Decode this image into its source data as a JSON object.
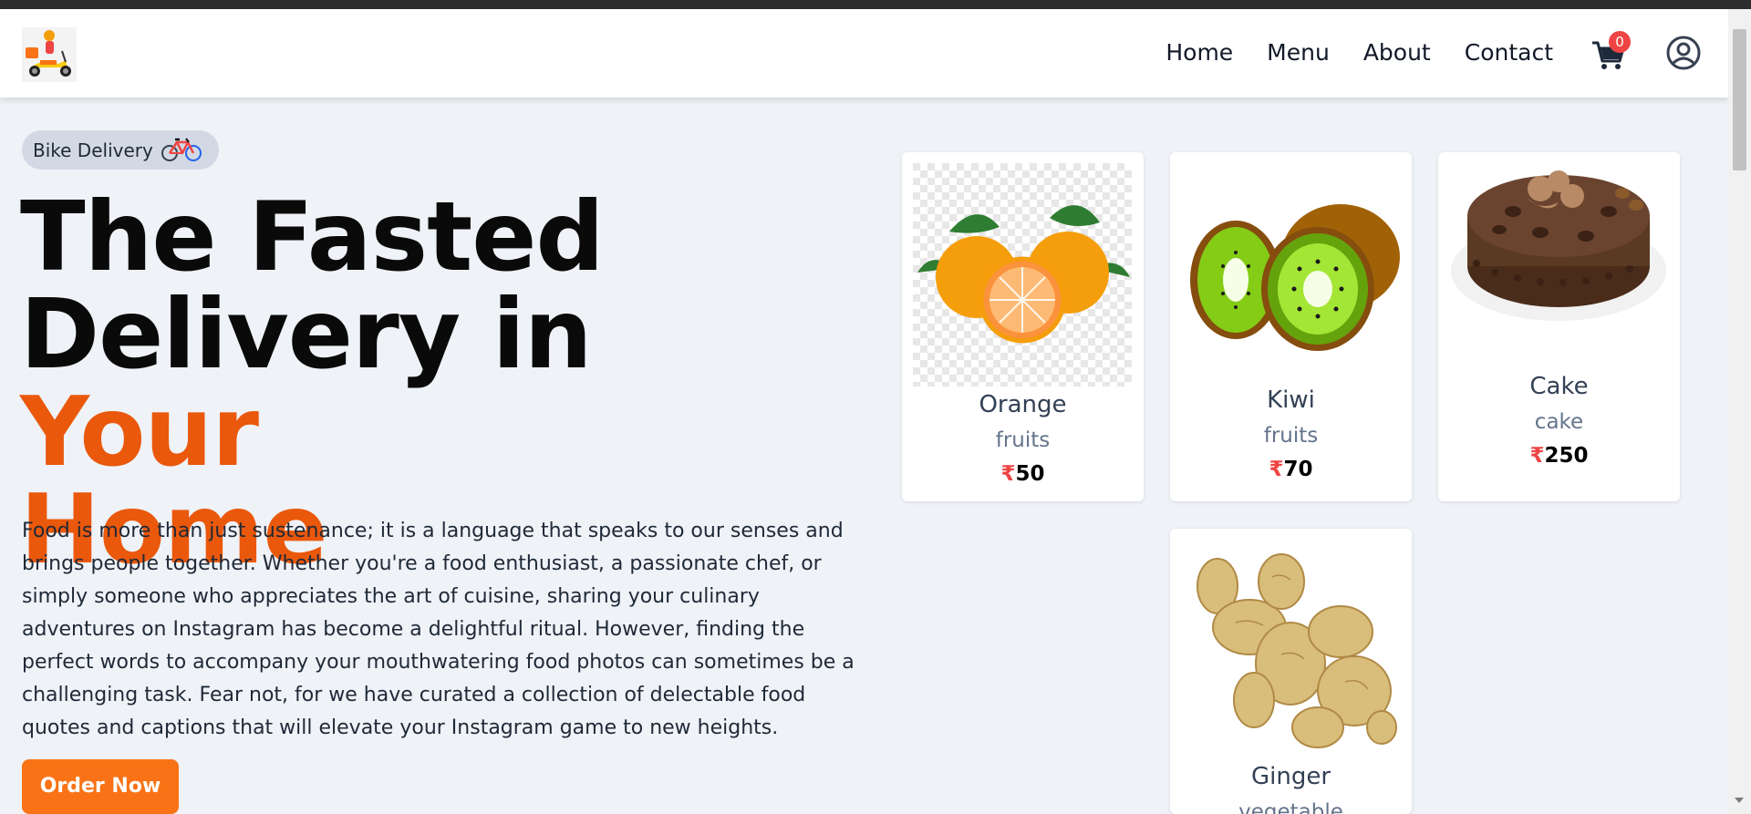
{
  "nav": {
    "logo_icon": "delivery-scooter-logo",
    "links": [
      "Home",
      "Menu",
      "About",
      "Contact"
    ],
    "cart_icon": "cart-icon",
    "cart_count": "0",
    "profile_icon": "user-circle-icon"
  },
  "hero": {
    "badge_text": "Bike Delivery",
    "badge_icon": "bicycle-icon",
    "title_line1": "The Fasted",
    "title_line2_part1": "Delivery in ",
    "title_line2_accent": "Your",
    "title_line3_accent": "Home",
    "description": "Food is more than just sustenance; it is a language that speaks to our senses and brings people together. Whether you're a food enthusiast, a passionate chef, or simply someone who appreciates the art of cuisine, sharing your culinary adventures on Instagram has become a delightful ritual. However, finding the perfect words to accompany your mouthwatering food photos can sometimes be a challenging task. Fear not, for we have curated a collection of delectable food quotes and captions that will elevate your Instagram game to new heights.",
    "cta_label": "Order Now"
  },
  "currency_symbol": "₹",
  "products": [
    {
      "name": "Orange",
      "category": "fruits",
      "price": "50",
      "image": "orange-image"
    },
    {
      "name": "Kiwi",
      "category": "fruits",
      "price": "70",
      "image": "kiwi-image"
    },
    {
      "name": "Cake",
      "category": "cake",
      "price": "250",
      "image": "cake-image"
    },
    {
      "name": "Ginger",
      "category": "vegetable",
      "image": "ginger-image"
    }
  ],
  "colors": {
    "accent": "#ea580c",
    "button": "#f97316",
    "badge_red": "#ef4444",
    "background": "#eff2f7"
  }
}
